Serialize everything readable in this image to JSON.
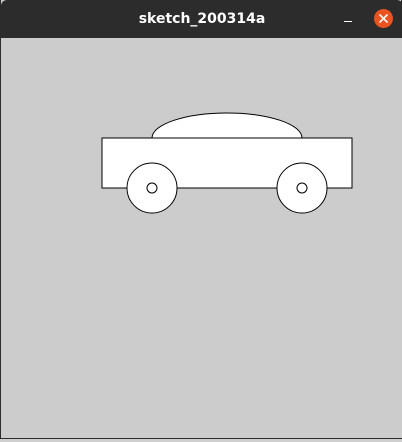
{
  "window": {
    "title": "sketch_200314a"
  },
  "icons": {
    "minimize": "minimize-icon",
    "close": "close-icon"
  },
  "colors": {
    "titlebar": "#2c2c2c",
    "title_text": "#ffffff",
    "close_button": "#e95420",
    "canvas_background": "#cccccc",
    "shape_fill": "#ffffff",
    "shape_stroke": "#000000"
  }
}
